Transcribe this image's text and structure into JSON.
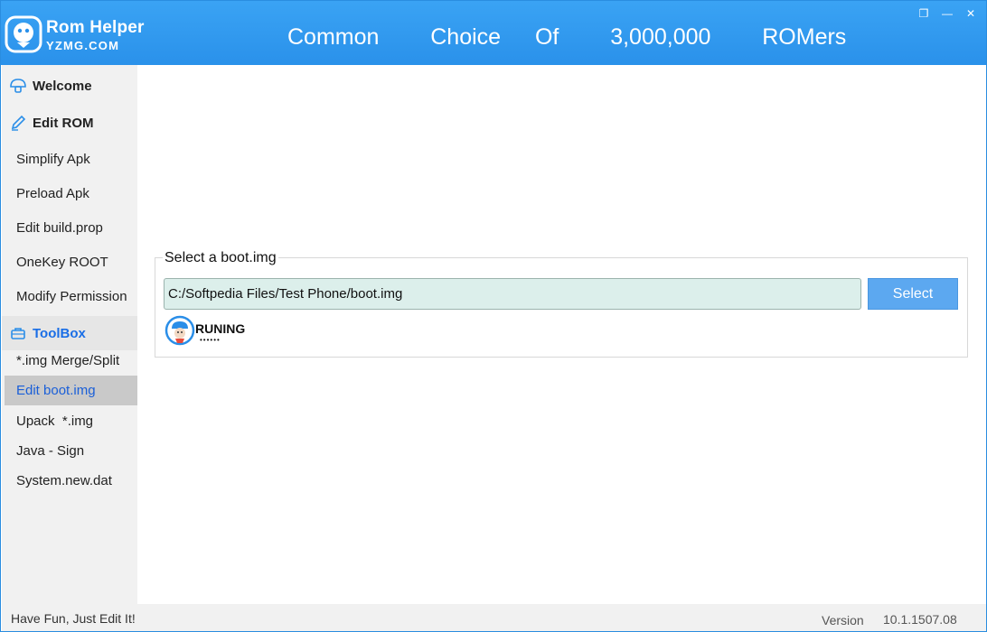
{
  "app": {
    "logo_title": "Rom Helper",
    "logo_sub": "YZMG.COM",
    "slogan": "Common   Choice  Of   3,000,000   ROMers",
    "window_buttons": [
      "restore-icon",
      "minimize-icon",
      "close-icon"
    ],
    "window_glyphs": [
      "❐",
      "—",
      "✕"
    ]
  },
  "sidebar": {
    "welcome": "Welcome",
    "edit_rom": "Edit ROM",
    "edit_rom_items": [
      "Simplify Apk",
      "Preload Apk",
      "Edit build.prop",
      "OneKey ROOT",
      "Modify Permission"
    ],
    "toolbox": "ToolBox",
    "toolbox_items": [
      "*.img Merge/Split",
      "Edit boot.img",
      "Upack  *.img",
      "Java - Sign",
      "System.new.dat"
    ],
    "active_item": "Edit boot.img"
  },
  "main": {
    "group_label": "Select a boot.img",
    "path_value": "C:/Softpedia Files/Test Phone/boot.img",
    "select_label": "Select",
    "running_label": "RUNING",
    "running_dots": "••••••"
  },
  "status": {
    "left": "Have Fun, Just Edit It!",
    "version_label": "Version",
    "version": "10.1.1507.08"
  },
  "colors": {
    "header": "#2a91ea",
    "accent": "#1a6ee6",
    "input_bg": "#dcefeb",
    "select_button": "#5ca8f0",
    "sidebar_bg": "#f1f1f1",
    "active_bg": "#c9c9c9"
  }
}
